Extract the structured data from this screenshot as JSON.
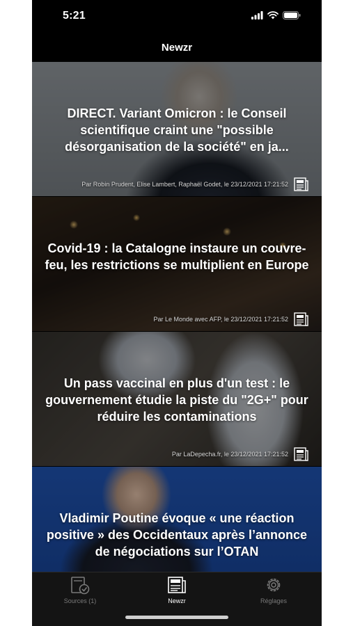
{
  "status_bar": {
    "time": "5:21"
  },
  "nav": {
    "title": "Newzr"
  },
  "articles": [
    {
      "headline": "DIRECT. Variant Omicron : le Conseil scientifique craint une \"possible désorganisation de la société\" en ja...",
      "byline": "Par Robin Prudent, Elise Lambert, Raphaël Godet, le 23/12/2021 17:21:52"
    },
    {
      "headline": "Covid-19 : la Catalogne instaure un couvre-feu, les restrictions se multiplient en Europe",
      "byline": "Par Le Monde avec AFP, le 23/12/2021 17:21:52"
    },
    {
      "headline": "Un pass vaccinal en plus d'un test : le gouvernement étudie la piste du \"2G+\" pour réduire les contaminations",
      "byline": "Par LaDepecha.fr, le 23/12/2021 17:21:52"
    },
    {
      "headline": "Vladimir Poutine évoque « une réaction positive » des Occidentaux après l’annonce de négociations sur l’OTAN",
      "byline": ""
    }
  ],
  "tabs": [
    {
      "label": "Sources (1)",
      "icon": "sources-icon"
    },
    {
      "label": "Newzr",
      "icon": "newspaper-icon"
    },
    {
      "label": "Réglages",
      "icon": "gear-icon"
    }
  ],
  "colors": {
    "tab_active": "#ffffff",
    "tab_inactive": "#7a7a7a",
    "background": "#000000"
  }
}
